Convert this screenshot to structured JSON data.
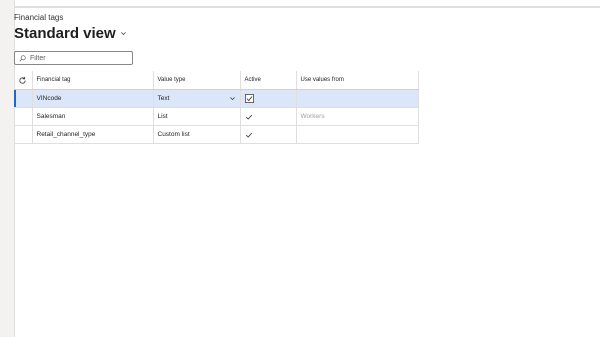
{
  "page": {
    "caption": "Financial tags",
    "view_title": "Standard view"
  },
  "filter": {
    "placeholder": "Filter"
  },
  "grid": {
    "headers": {
      "financial_tag": "Financial tag",
      "value_type": "Value type",
      "active": "Active",
      "use_values_from": "Use values from"
    },
    "rows": [
      {
        "financial_tag": "VINcode",
        "value_type": "Text",
        "active": true,
        "use_values_from": "",
        "selected": true
      },
      {
        "financial_tag": "Salesman",
        "value_type": "List",
        "active": true,
        "use_values_from": "Workers",
        "selected": false
      },
      {
        "financial_tag": "Retail_channel_type",
        "value_type": "Custom list",
        "active": true,
        "use_values_from": "",
        "selected": false
      }
    ]
  },
  "icons": {
    "refresh": "refresh-icon",
    "search": "search-icon",
    "chevron": "chevron-down-icon",
    "check": "checkmark-icon"
  },
  "colors": {
    "selected_row": "#dbe7f8",
    "selection_marker": "#2266c6"
  }
}
